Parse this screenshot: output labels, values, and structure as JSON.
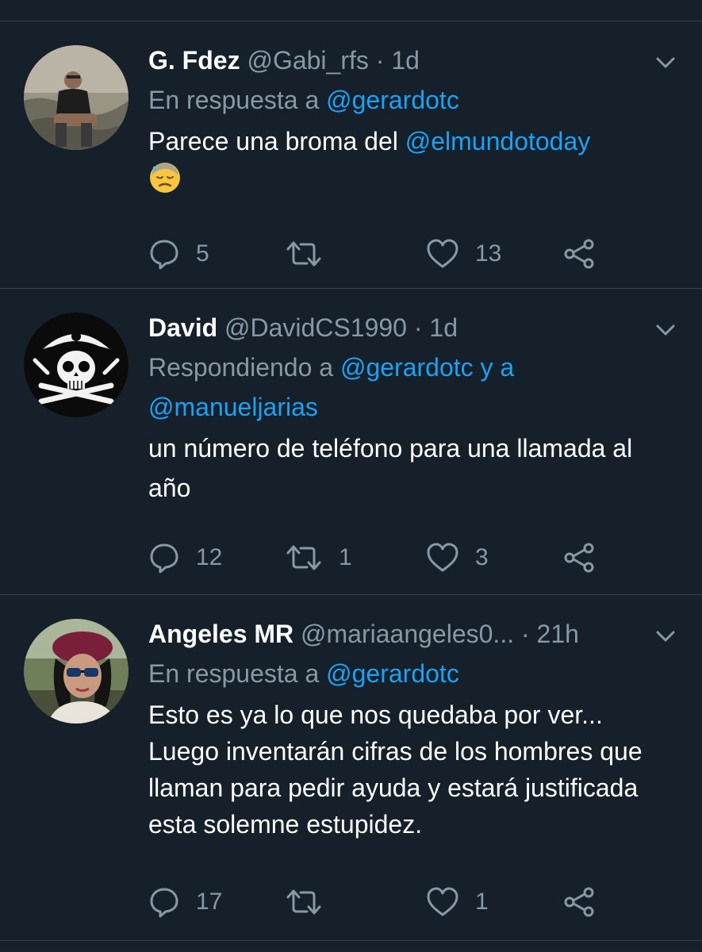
{
  "colors": {
    "background": "#15202b",
    "divider": "#38444d",
    "secondary_text": "#8899a6",
    "mention": "#1da1f2"
  },
  "tweets": [
    {
      "name": "G. Fdez",
      "handle": "@Gabi_rfs",
      "separator": "·",
      "time": "1d",
      "reply_prefix": "En respuesta a ",
      "reply_mentions": "@gerardotc",
      "reply_line2": "",
      "text_before": "Parece una broma del ",
      "text_mention": "@elmundotoday",
      "emoji": "downcast-face-with-sweat",
      "reply_count": "5",
      "retweet_count": "",
      "like_count": "13"
    },
    {
      "name": "David",
      "handle": "@DavidCS1990",
      "separator": "·",
      "time": "1d",
      "reply_prefix": "Respondiendo a ",
      "reply_mentions": "@gerardotc y a",
      "reply_line2": "@manueljarias",
      "text": "un número de teléfono para una llamada al año",
      "reply_count": "12",
      "retweet_count": "1",
      "like_count": "3"
    },
    {
      "name": "Angeles MR",
      "handle": "@mariaangeles0...",
      "separator": "·",
      "time": "21h",
      "reply_prefix": "En respuesta a ",
      "reply_mentions": "@gerardotc",
      "reply_line2": "",
      "text": "Esto es ya lo que nos quedaba por ver... Luego inventarán cifras de los hombres que llaman para pedir ayuda y estará justificada esta solemne estupidez.",
      "reply_count": "17",
      "retweet_count": "",
      "like_count": "1"
    }
  ],
  "icons": {
    "reply": "reply-icon",
    "retweet": "retweet-icon",
    "like": "heart-icon",
    "share": "share-icon",
    "menu": "chevron-down-icon"
  }
}
